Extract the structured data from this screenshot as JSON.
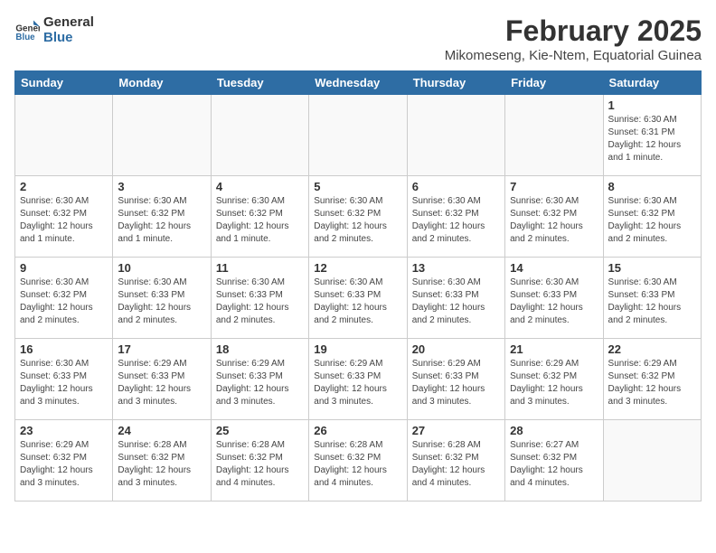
{
  "logo": {
    "line1": "General",
    "line2": "Blue"
  },
  "title": "February 2025",
  "location": "Mikomeseng, Kie-Ntem, Equatorial Guinea",
  "days_of_week": [
    "Sunday",
    "Monday",
    "Tuesday",
    "Wednesday",
    "Thursday",
    "Friday",
    "Saturday"
  ],
  "weeks": [
    [
      {
        "day": "",
        "info": ""
      },
      {
        "day": "",
        "info": ""
      },
      {
        "day": "",
        "info": ""
      },
      {
        "day": "",
        "info": ""
      },
      {
        "day": "",
        "info": ""
      },
      {
        "day": "",
        "info": ""
      },
      {
        "day": "1",
        "info": "Sunrise: 6:30 AM\nSunset: 6:31 PM\nDaylight: 12 hours\nand 1 minute."
      }
    ],
    [
      {
        "day": "2",
        "info": "Sunrise: 6:30 AM\nSunset: 6:32 PM\nDaylight: 12 hours\nand 1 minute."
      },
      {
        "day": "3",
        "info": "Sunrise: 6:30 AM\nSunset: 6:32 PM\nDaylight: 12 hours\nand 1 minute."
      },
      {
        "day": "4",
        "info": "Sunrise: 6:30 AM\nSunset: 6:32 PM\nDaylight: 12 hours\nand 1 minute."
      },
      {
        "day": "5",
        "info": "Sunrise: 6:30 AM\nSunset: 6:32 PM\nDaylight: 12 hours\nand 2 minutes."
      },
      {
        "day": "6",
        "info": "Sunrise: 6:30 AM\nSunset: 6:32 PM\nDaylight: 12 hours\nand 2 minutes."
      },
      {
        "day": "7",
        "info": "Sunrise: 6:30 AM\nSunset: 6:32 PM\nDaylight: 12 hours\nand 2 minutes."
      },
      {
        "day": "8",
        "info": "Sunrise: 6:30 AM\nSunset: 6:32 PM\nDaylight: 12 hours\nand 2 minutes."
      }
    ],
    [
      {
        "day": "9",
        "info": "Sunrise: 6:30 AM\nSunset: 6:32 PM\nDaylight: 12 hours\nand 2 minutes."
      },
      {
        "day": "10",
        "info": "Sunrise: 6:30 AM\nSunset: 6:33 PM\nDaylight: 12 hours\nand 2 minutes."
      },
      {
        "day": "11",
        "info": "Sunrise: 6:30 AM\nSunset: 6:33 PM\nDaylight: 12 hours\nand 2 minutes."
      },
      {
        "day": "12",
        "info": "Sunrise: 6:30 AM\nSunset: 6:33 PM\nDaylight: 12 hours\nand 2 minutes."
      },
      {
        "day": "13",
        "info": "Sunrise: 6:30 AM\nSunset: 6:33 PM\nDaylight: 12 hours\nand 2 minutes."
      },
      {
        "day": "14",
        "info": "Sunrise: 6:30 AM\nSunset: 6:33 PM\nDaylight: 12 hours\nand 2 minutes."
      },
      {
        "day": "15",
        "info": "Sunrise: 6:30 AM\nSunset: 6:33 PM\nDaylight: 12 hours\nand 2 minutes."
      }
    ],
    [
      {
        "day": "16",
        "info": "Sunrise: 6:30 AM\nSunset: 6:33 PM\nDaylight: 12 hours\nand 3 minutes."
      },
      {
        "day": "17",
        "info": "Sunrise: 6:29 AM\nSunset: 6:33 PM\nDaylight: 12 hours\nand 3 minutes."
      },
      {
        "day": "18",
        "info": "Sunrise: 6:29 AM\nSunset: 6:33 PM\nDaylight: 12 hours\nand 3 minutes."
      },
      {
        "day": "19",
        "info": "Sunrise: 6:29 AM\nSunset: 6:33 PM\nDaylight: 12 hours\nand 3 minutes."
      },
      {
        "day": "20",
        "info": "Sunrise: 6:29 AM\nSunset: 6:33 PM\nDaylight: 12 hours\nand 3 minutes."
      },
      {
        "day": "21",
        "info": "Sunrise: 6:29 AM\nSunset: 6:32 PM\nDaylight: 12 hours\nand 3 minutes."
      },
      {
        "day": "22",
        "info": "Sunrise: 6:29 AM\nSunset: 6:32 PM\nDaylight: 12 hours\nand 3 minutes."
      }
    ],
    [
      {
        "day": "23",
        "info": "Sunrise: 6:29 AM\nSunset: 6:32 PM\nDaylight: 12 hours\nand 3 minutes."
      },
      {
        "day": "24",
        "info": "Sunrise: 6:28 AM\nSunset: 6:32 PM\nDaylight: 12 hours\nand 3 minutes."
      },
      {
        "day": "25",
        "info": "Sunrise: 6:28 AM\nSunset: 6:32 PM\nDaylight: 12 hours\nand 4 minutes."
      },
      {
        "day": "26",
        "info": "Sunrise: 6:28 AM\nSunset: 6:32 PM\nDaylight: 12 hours\nand 4 minutes."
      },
      {
        "day": "27",
        "info": "Sunrise: 6:28 AM\nSunset: 6:32 PM\nDaylight: 12 hours\nand 4 minutes."
      },
      {
        "day": "28",
        "info": "Sunrise: 6:27 AM\nSunset: 6:32 PM\nDaylight: 12 hours\nand 4 minutes."
      },
      {
        "day": "",
        "info": ""
      }
    ]
  ]
}
